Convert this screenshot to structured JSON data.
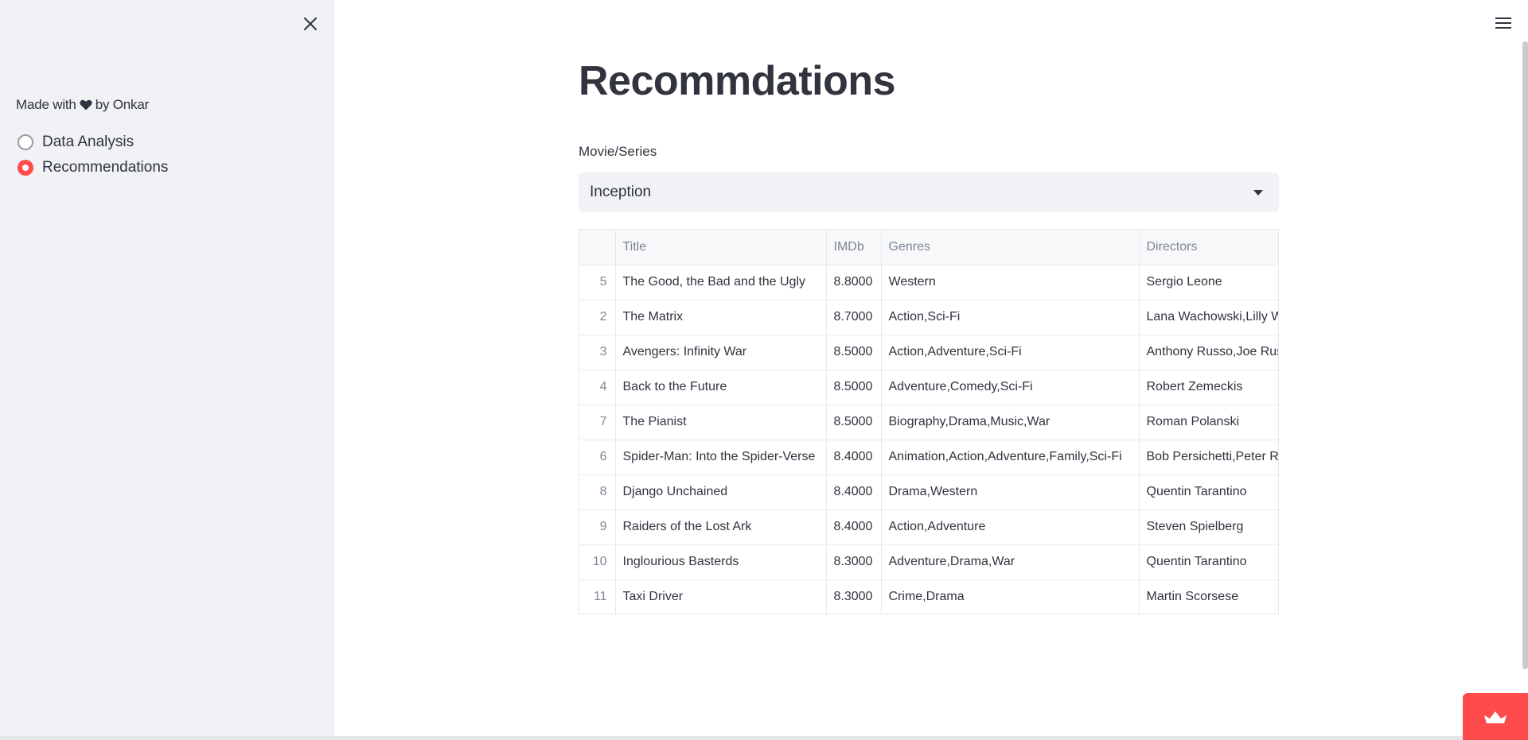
{
  "sidebar": {
    "made_with_prefix": "Made with",
    "made_with_suffix": "by Onkar",
    "nav": [
      {
        "label": "Data Analysis",
        "selected": false
      },
      {
        "label": "Recommendations",
        "selected": true
      }
    ]
  },
  "main": {
    "title": "Recommdations",
    "select": {
      "label": "Movie/Series",
      "value": "Inception"
    },
    "table": {
      "columns": [
        "",
        "Title",
        "IMDb",
        "Genres",
        "Directors"
      ],
      "rows": [
        [
          "5",
          "The Good, the Bad and the Ugly",
          "8.8000",
          "Western",
          "Sergio Leone"
        ],
        [
          "2",
          "The Matrix",
          "8.7000",
          "Action,Sci-Fi",
          "Lana Wachowski,Lilly Wachowski"
        ],
        [
          "3",
          "Avengers: Infinity War",
          "8.5000",
          "Action,Adventure,Sci-Fi",
          "Anthony Russo,Joe Russo"
        ],
        [
          "4",
          "Back to the Future",
          "8.5000",
          "Adventure,Comedy,Sci-Fi",
          "Robert Zemeckis"
        ],
        [
          "7",
          "The Pianist",
          "8.5000",
          "Biography,Drama,Music,War",
          "Roman Polanski"
        ],
        [
          "6",
          "Spider-Man: Into the Spider-Verse",
          "8.4000",
          "Animation,Action,Adventure,Family,Sci-Fi",
          "Bob Persichetti,Peter Ramsey"
        ],
        [
          "8",
          "Django Unchained",
          "8.4000",
          "Drama,Western",
          "Quentin Tarantino"
        ],
        [
          "9",
          "Raiders of the Lost Ark",
          "8.4000",
          "Action,Adventure",
          "Steven Spielberg"
        ],
        [
          "10",
          "Inglourious Basterds",
          "8.3000",
          "Adventure,Drama,War",
          "Quentin Tarantino"
        ],
        [
          "11",
          "Taxi Driver",
          "8.3000",
          "Crime,Drama",
          "Martin Scorsese"
        ]
      ]
    }
  },
  "icons": {
    "close": "close-icon",
    "menu": "hamburger-menu-icon",
    "heart": "heart-icon",
    "dropdown": "chevron-down-icon",
    "badge": "crown-icon"
  },
  "colors": {
    "accent": "#ff4b4b",
    "sidebar_bg": "#f0f2f6",
    "text": "#31333f"
  }
}
